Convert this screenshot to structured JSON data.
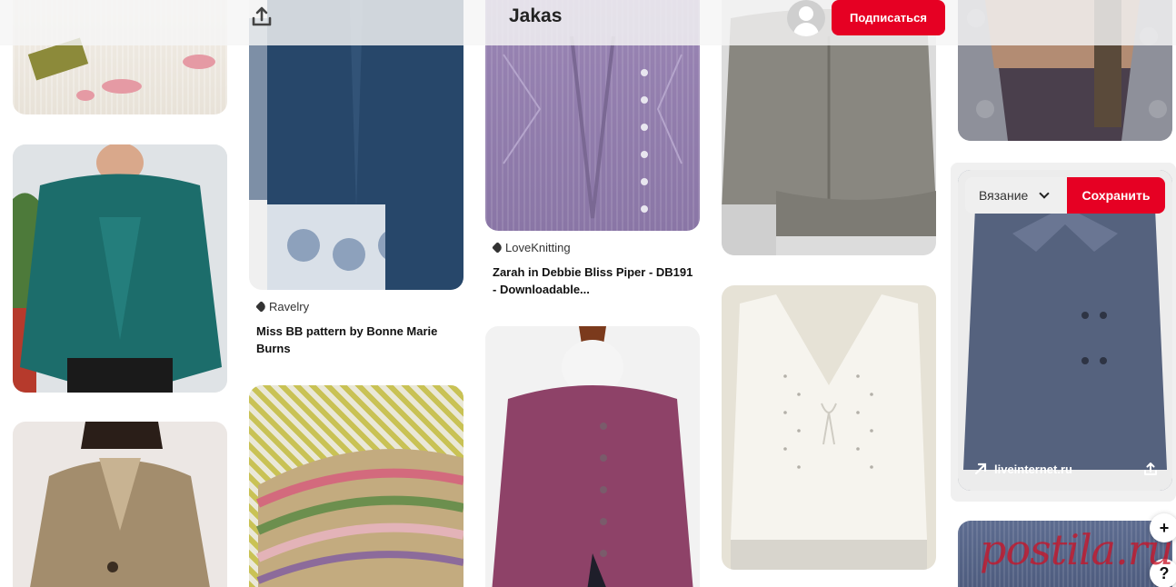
{
  "board": {
    "name": "Jakas",
    "subscribe_label": "Подписаться"
  },
  "pins": [
    {
      "source": "Ravelry",
      "title_line1": "Miss BB pattern by Bonne Marie",
      "title_line2": "Burns"
    },
    {
      "source": "LoveKnitting",
      "title_line1": "Zarah in Debbie Bliss Piper - DB191",
      "title_line2": "- Downloadable..."
    }
  ],
  "hover": {
    "board_label": "Вязание",
    "save_label": "Сохранить",
    "link": "liveinternet.ru"
  },
  "floating": {
    "plus": "+",
    "help": "?"
  },
  "watermark": "postila.ru",
  "colors": {
    "accent": "#e60023"
  },
  "icons": [
    "share-icon",
    "tag-icon",
    "chevron-down-icon",
    "arrow-up-right-icon",
    "plus-icon",
    "help-icon",
    "avatar-icon"
  ]
}
